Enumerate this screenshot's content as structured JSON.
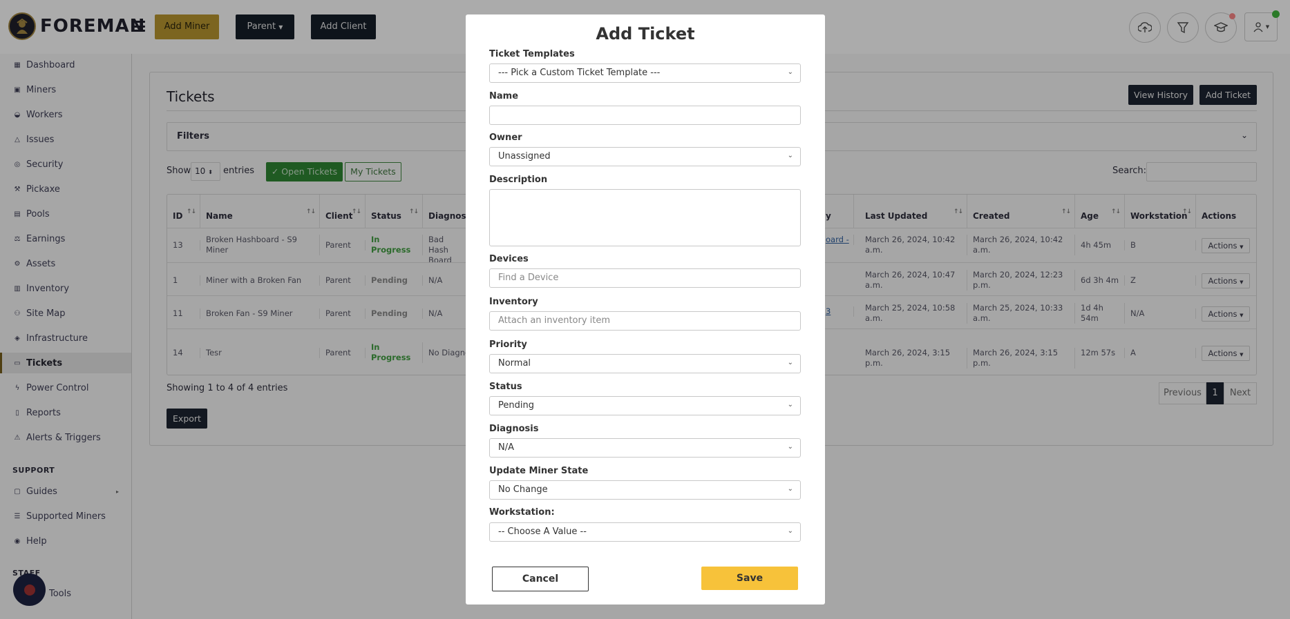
{
  "app": {
    "logo_text": "FOREMAN"
  },
  "topbar": {
    "add_miner": "Add Miner",
    "parent": "Parent",
    "add_client": "Add Client"
  },
  "sidebar": {
    "items": [
      {
        "label": "Dashboard",
        "icon": "dashboard-icon"
      },
      {
        "label": "Miners",
        "icon": "miner-icon"
      },
      {
        "label": "Workers",
        "icon": "workers-icon"
      },
      {
        "label": "Issues",
        "icon": "warning-icon"
      },
      {
        "label": "Security",
        "icon": "shield-icon"
      },
      {
        "label": "Pickaxe",
        "icon": "pickaxe-icon"
      },
      {
        "label": "Pools",
        "icon": "pools-icon"
      },
      {
        "label": "Earnings",
        "icon": "earnings-icon"
      },
      {
        "label": "Assets",
        "icon": "assets-icon"
      },
      {
        "label": "Inventory",
        "icon": "inventory-icon"
      },
      {
        "label": "Site Map",
        "icon": "sitemap-icon"
      },
      {
        "label": "Infrastructure",
        "icon": "layers-icon"
      },
      {
        "label": "Tickets",
        "icon": "ticket-icon"
      },
      {
        "label": "Power Control",
        "icon": "bolt-icon"
      },
      {
        "label": "Reports",
        "icon": "report-icon"
      },
      {
        "label": "Alerts & Triggers",
        "icon": "alert-icon"
      }
    ],
    "support_title": "SUPPORT",
    "support_items": [
      {
        "label": "Guides",
        "icon": "guide-icon"
      },
      {
        "label": "Supported Miners",
        "icon": "list-icon"
      },
      {
        "label": "Help",
        "icon": "help-icon"
      }
    ],
    "staff_title": "STAFF",
    "tools": "Tools"
  },
  "page": {
    "title": "Tickets",
    "view_history": "View History",
    "add_ticket": "Add Ticket",
    "filters": "Filters",
    "show": "Show",
    "entries_value": "10",
    "entries": "entries",
    "open_tickets": "Open Tickets",
    "my_tickets": "My Tickets",
    "search_label": "Search:",
    "showing": "Showing 1 to 4 of 4 entries",
    "export": "Export",
    "previous": "Previous",
    "page_num": "1",
    "next": "Next"
  },
  "table": {
    "headers": {
      "id": "ID",
      "name": "Name",
      "client": "Client",
      "status": "Status",
      "diagnosis": "Diagnosis",
      "history": "y",
      "last_updated": "Last Updated",
      "created": "Created",
      "age": "Age",
      "workstation": "Workstation",
      "actions": "Actions"
    },
    "rows": [
      {
        "id": "13",
        "name": "Broken Hashboard - S9 Miner",
        "client": "Parent",
        "status": "In Progress",
        "diagnosis": "Bad Hash Board",
        "history": "oard -",
        "last_updated": "March 26, 2024, 10:42 a.m.",
        "created": "March 26, 2024, 10:42 a.m.",
        "age": "4h 45m",
        "workstation": "B",
        "actions": "Actions"
      },
      {
        "id": "1",
        "name": "Miner with a Broken Fan",
        "client": "Parent",
        "status": "Pending",
        "diagnosis": "N/A",
        "history": "",
        "last_updated": "March 26, 2024, 10:47 a.m.",
        "created": "March 20, 2024, 12:23 p.m.",
        "age": "6d 3h 4m",
        "workstation": "Z",
        "actions": "Actions"
      },
      {
        "id": "11",
        "name": "Broken Fan - S9 Miner",
        "client": "Parent",
        "status": "Pending",
        "diagnosis": "N/A",
        "history": "3",
        "last_updated": "March 25, 2024, 10:58 a.m.",
        "created": "March 25, 2024, 10:33 a.m.",
        "age": "1d 4h 54m",
        "workstation": "N/A",
        "actions": "Actions"
      },
      {
        "id": "14",
        "name": "Tesr",
        "client": "Parent",
        "status": "In Progress",
        "diagnosis": "No Diagno",
        "history": "",
        "last_updated": "March 26, 2024, 3:15 p.m.",
        "created": "March 26, 2024, 3:15 p.m.",
        "age": "12m 57s",
        "workstation": "A",
        "actions": "Actions"
      }
    ]
  },
  "modal": {
    "title": "Add Ticket",
    "templates_label": "Ticket Templates",
    "templates_value": "--- Pick a Custom Ticket Template ---",
    "name_label": "Name",
    "name_value": "",
    "owner_label": "Owner",
    "owner_value": "Unassigned",
    "description_label": "Description",
    "devices_label": "Devices",
    "devices_placeholder": "Find a Device",
    "inventory_label": "Inventory",
    "inventory_placeholder": "Attach an inventory item",
    "priority_label": "Priority",
    "priority_value": "Normal",
    "status_label": "Status",
    "status_value": "Pending",
    "diagnosis_label": "Diagnosis",
    "diagnosis_value": "N/A",
    "miner_state_label": "Update Miner State",
    "miner_state_value": "No Change",
    "workstation_label": "Workstation:",
    "workstation_value": "-- Choose A Value --",
    "cancel": "Cancel",
    "save": "Save"
  },
  "colors": {
    "accent_gold": "#f7c23a",
    "dark_button": "#131821",
    "open_tickets_green": "#1f5a22",
    "overlay": "#a6a6a6"
  }
}
